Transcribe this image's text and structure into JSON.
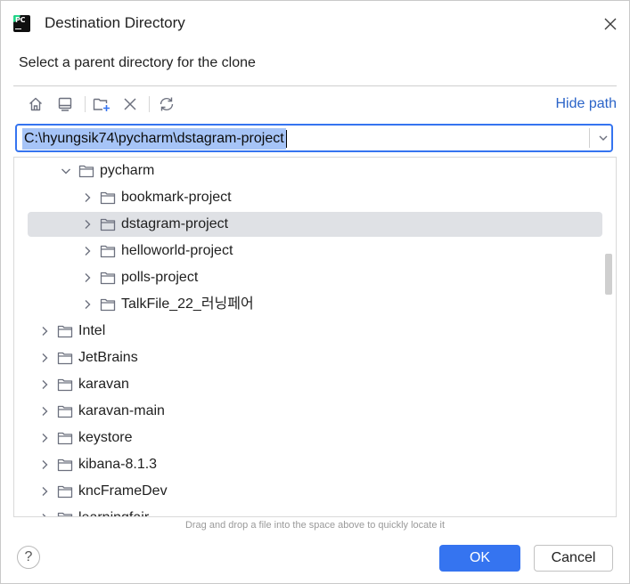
{
  "window": {
    "title": "Destination Directory",
    "subtitle": "Select a parent directory for the clone",
    "app_icon_text": "PC"
  },
  "toolbar": {
    "buttons": [
      "home-icon",
      "desktop-icon",
      "new-folder-icon",
      "delete-icon",
      "refresh-icon"
    ],
    "hide_path_label": "Hide path"
  },
  "path_field": {
    "value": "C:\\hyungsik74\\pycharm\\dstagram-project"
  },
  "tree": {
    "items": [
      {
        "label": "pycharm",
        "expanded": true,
        "selected": false
      },
      {
        "label": "bookmark-project",
        "expanded": false,
        "selected": false
      },
      {
        "label": "dstagram-project",
        "expanded": false,
        "selected": true
      },
      {
        "label": "helloworld-project",
        "expanded": false,
        "selected": false
      },
      {
        "label": "polls-project",
        "expanded": false,
        "selected": false
      },
      {
        "label": "TalkFile_22_러닝페어",
        "expanded": false,
        "selected": false
      },
      {
        "label": "Intel",
        "expanded": false,
        "selected": false
      },
      {
        "label": "JetBrains",
        "expanded": false,
        "selected": false
      },
      {
        "label": "karavan",
        "expanded": false,
        "selected": false
      },
      {
        "label": "karavan-main",
        "expanded": false,
        "selected": false
      },
      {
        "label": "keystore",
        "expanded": false,
        "selected": false
      },
      {
        "label": "kibana-8.1.3",
        "expanded": false,
        "selected": false
      },
      {
        "label": "kncFrameDev",
        "expanded": false,
        "selected": false
      },
      {
        "label": "learningfair",
        "expanded": false,
        "selected": false
      }
    ]
  },
  "hint": "Drag and drop a file into the space above to quickly locate it",
  "footer": {
    "help_label": "?",
    "ok_label": "OK",
    "cancel_label": "Cancel"
  },
  "colors": {
    "accent": "#3574f0",
    "link": "#2b64c8",
    "selection": "#dfe1e5",
    "text_selection": "#a6c4f7"
  }
}
